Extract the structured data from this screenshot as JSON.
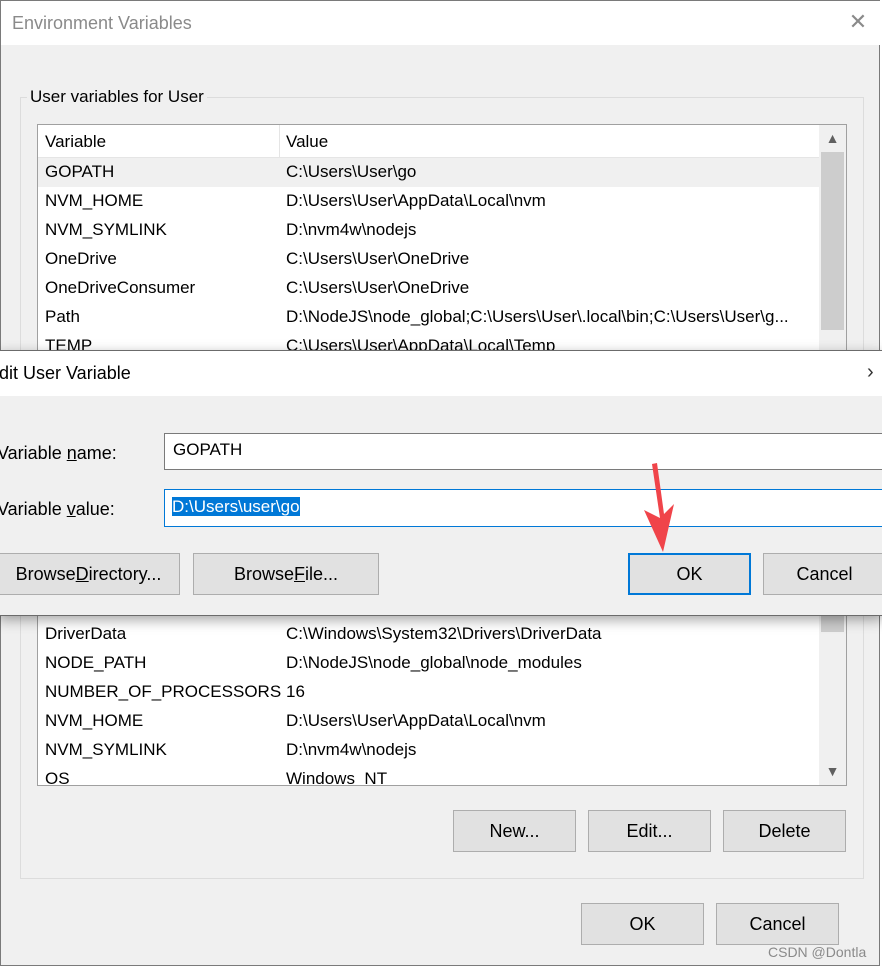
{
  "env_window": {
    "title": "Environment Variables",
    "close_glyph": "✕",
    "user_group_label": "User variables for User",
    "columns": [
      "Variable",
      "Value"
    ],
    "user_rows": [
      {
        "name": "GOPATH",
        "value": "C:\\Users\\User\\go"
      },
      {
        "name": "NVM_HOME",
        "value": "D:\\Users\\User\\AppData\\Local\\nvm"
      },
      {
        "name": "NVM_SYMLINK",
        "value": "D:\\nvm4w\\nodejs"
      },
      {
        "name": "OneDrive",
        "value": "C:\\Users\\User\\OneDrive"
      },
      {
        "name": "OneDriveConsumer",
        "value": "C:\\Users\\User\\OneDrive"
      },
      {
        "name": "Path",
        "value": "D:\\NodeJS\\node_global;C:\\Users\\User\\.local\\bin;C:\\Users\\User\\g..."
      },
      {
        "name": "TEMP",
        "value": "C:\\Users\\User\\AppData\\Local\\Temp"
      }
    ],
    "system_rows": [
      {
        "name": "DriverData",
        "value": "C:\\Windows\\System32\\Drivers\\DriverData"
      },
      {
        "name": "NODE_PATH",
        "value": "D:\\NodeJS\\node_global\\node_modules"
      },
      {
        "name": "NUMBER_OF_PROCESSORS",
        "value": "16"
      },
      {
        "name": "NVM_HOME",
        "value": "D:\\Users\\User\\AppData\\Local\\nvm"
      },
      {
        "name": "NVM_SYMLINK",
        "value": "D:\\nvm4w\\nodejs"
      },
      {
        "name": "OS",
        "value": "Windows_NT"
      }
    ],
    "system_buttons": {
      "new": "New...",
      "edit": "Edit...",
      "delete": "Delete"
    },
    "ok": "OK",
    "cancel": "Cancel"
  },
  "edit_dialog": {
    "title": "dit User Variable",
    "close_glyph": "›",
    "name_label": "Variable name:",
    "value_label": "Variable value:",
    "name_value": "GOPATH",
    "value_value": "D:\\Users\\user\\go",
    "browse_directory": "Browse Directory...",
    "browse_file": "Browse File...",
    "ok": "OK",
    "cancel": "Cancel"
  },
  "icons": {
    "scroll_up": "▲",
    "scroll_down": "▼"
  },
  "colors": {
    "accent": "#0078d7",
    "annotation_arrow": "#f0444a"
  },
  "watermark": "CSDN @Dontla"
}
